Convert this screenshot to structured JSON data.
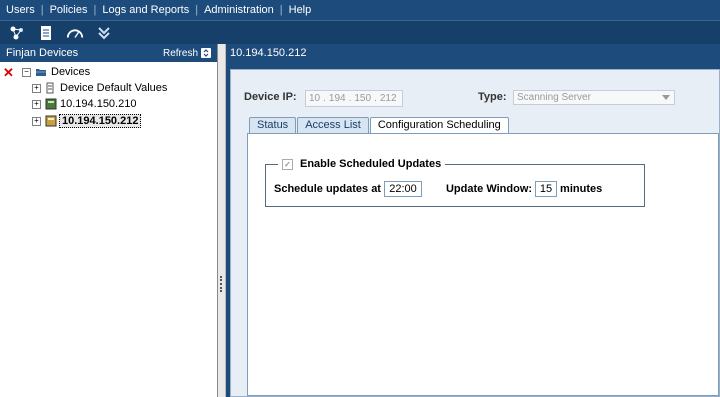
{
  "menu": {
    "items": [
      "Users",
      "Policies",
      "Logs and Reports",
      "Administration",
      "Help"
    ],
    "separator": "|"
  },
  "toolbar": {
    "icons": [
      "network-icon",
      "document-icon",
      "gauge-icon",
      "download-icon"
    ]
  },
  "left_panel": {
    "title": "Finjan Devices",
    "refresh_label": "Refresh",
    "tree": {
      "root": "Devices",
      "children": [
        "Device Default Values",
        "10.194.150.210",
        "10.194.150.212"
      ]
    }
  },
  "right_panel": {
    "header": "10.194.150.212",
    "device_ip_label": "Device IP:",
    "ip_octets": [
      "10",
      "194",
      "150",
      "212"
    ],
    "type_label": "Type:",
    "type_value": "Scanning Server",
    "tabs": [
      "Status",
      "Access List",
      "Configuration Scheduling"
    ],
    "active_tab": "Configuration Scheduling",
    "scheduling": {
      "enable_label": "Enable Scheduled Updates",
      "schedule_label": "Schedule updates at",
      "schedule_value": "22:00",
      "window_label": "Update Window:",
      "window_value": "15",
      "window_unit": "minutes"
    }
  },
  "colors": {
    "menubar_bg": "#1d4b7c",
    "panel_bg": "#e8eef5",
    "tab_bg": "#d7e5f3",
    "delete_red": "#dd0000"
  }
}
